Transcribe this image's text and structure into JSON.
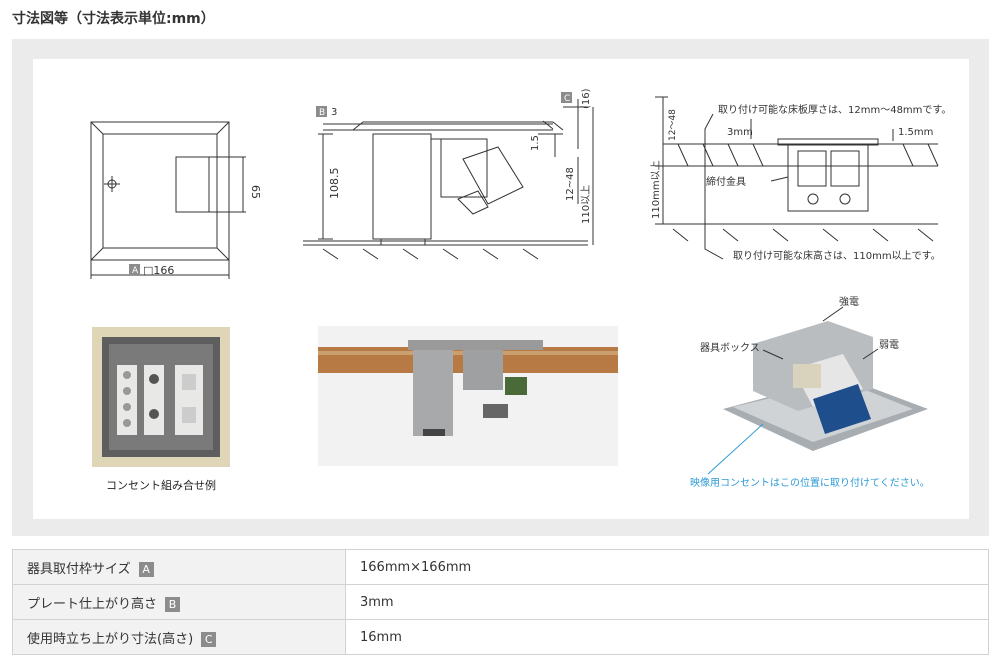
{
  "title": "寸法図等（寸法表示単位:mm）",
  "drawing1": {
    "dim_side": "65",
    "label_a": "A",
    "dim_width": "□166"
  },
  "drawing2": {
    "label_b": "B",
    "dim_b": "3",
    "label_c": "C",
    "dim_c": "(16)",
    "dim_depth": "108.5",
    "dim_offset": "1.5",
    "dim_floor": "12~48",
    "dim_height": "110以上"
  },
  "drawing3": {
    "note_thickness": "取り付け可能な床板厚さは、12mm～48mmです。",
    "dim_range": "12～48",
    "dim_3mm": "3mm",
    "dim_15mm": "1.5mm",
    "label_bracket": "締付金具",
    "dim_110": "110mm以上",
    "note_height": "取り付け可能な床高さは、110mm以上です。"
  },
  "photo1": {
    "caption": "コンセント組み合せ例"
  },
  "photo3": {
    "label_strong": "強電",
    "label_weak": "弱電",
    "label_box": "器具ボックス",
    "caption_blue": "映像用コンセントはこの位置に取り付けてください。"
  },
  "spec_rows": [
    {
      "label": "器具取付枠サイズ",
      "badge": "A",
      "value": "166mm×166mm"
    },
    {
      "label": "プレート仕上がり高さ",
      "badge": "B",
      "value": "3mm"
    },
    {
      "label": "使用時立ち上がり寸法(高さ)",
      "badge": "C",
      "value": "16mm"
    }
  ]
}
